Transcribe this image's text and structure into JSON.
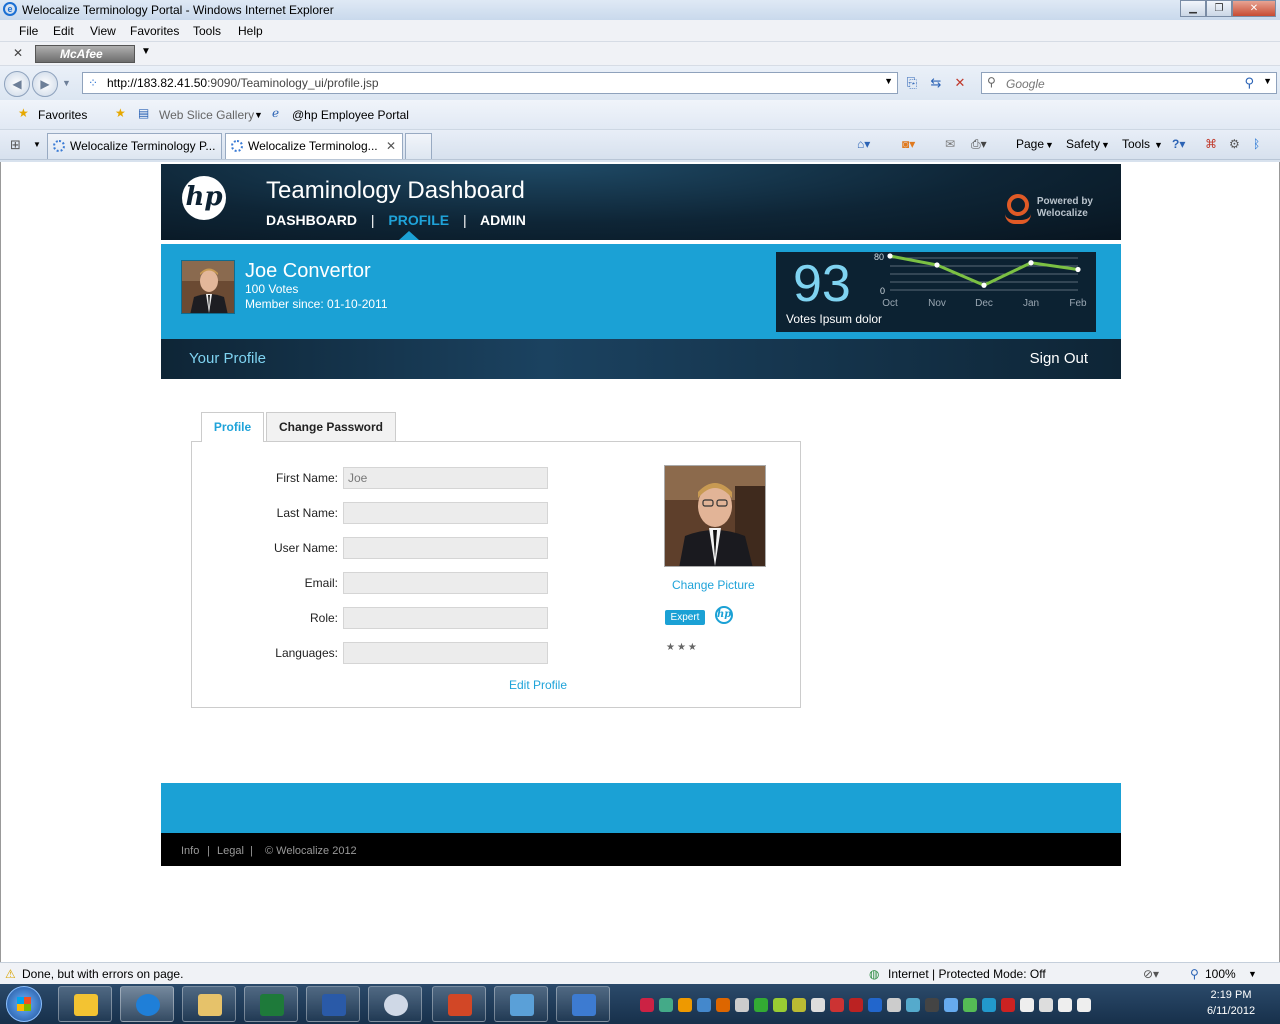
{
  "browser": {
    "window_title": "Welocalize Terminology Portal - Windows Internet Explorer",
    "menu": [
      "File",
      "Edit",
      "View",
      "Favorites",
      "Tools",
      "Help"
    ],
    "mcafee_label": "McAfee",
    "url_host": "http://183.82.41.50",
    "url_path": ":9090/Teaminology_ui/profile.jsp",
    "search_placeholder": "Google",
    "favorites_label": "Favorites",
    "fav_items": [
      "Web Slice Gallery",
      "@hp Employee Portal"
    ],
    "tabs": [
      "Welocalize Terminology P...",
      "Welocalize Terminolog..."
    ],
    "commands": [
      "Page",
      "Safety",
      "Tools"
    ]
  },
  "site": {
    "title": "Teaminology Dashboard",
    "nav": [
      "DASHBOARD",
      "PROFILE",
      "ADMIN"
    ],
    "nav_sep": "|",
    "powered_line1": "Powered by",
    "powered_line2": "Welocalize",
    "hp_logo": "hp"
  },
  "user": {
    "name": "Joe Convertor",
    "votes": "100 Votes",
    "member_since": "Member since: 01-10-2011"
  },
  "votes_widget": {
    "number": "93",
    "label": "Votes Ipsum dolor"
  },
  "chart_data": {
    "type": "line",
    "categories": [
      "Oct",
      "Nov",
      "Dec",
      "Jan",
      "Feb"
    ],
    "series": [
      {
        "values": [
          80,
          60,
          15,
          65,
          50
        ]
      }
    ],
    "ylim": [
      0,
      80
    ],
    "ytick_labels": [
      "80",
      "0"
    ],
    "color": "#7bc043"
  },
  "subnav": {
    "left": "Your Profile",
    "right": "Sign Out"
  },
  "profile_tabs": [
    "Profile",
    "Change Password"
  ],
  "form": {
    "fields": [
      {
        "label": "First Name:",
        "value": "Joe"
      },
      {
        "label": "Last Name:",
        "value": ""
      },
      {
        "label": "User Name:",
        "value": ""
      },
      {
        "label": "Email:",
        "value": ""
      },
      {
        "label": "Role:",
        "value": ""
      },
      {
        "label": "Languages:",
        "value": ""
      }
    ],
    "edit_link": "Edit Profile"
  },
  "photo_panel": {
    "change_picture": "Change Picture",
    "badge": "Expert",
    "stars": "★★★"
  },
  "footer": {
    "items": [
      "Info",
      "|",
      "Legal",
      "|",
      "© Welocalize 2012"
    ]
  },
  "statusbar": {
    "message": "Done, but with errors on page.",
    "zone": "Internet | Protected Mode: Off",
    "zoom": "100%"
  },
  "taskbar": {
    "time": "2:19 PM",
    "date": "6/11/2012"
  },
  "colors": {
    "accent": "#1ba1d5",
    "header_dark": "#0e2536",
    "link": "#1fa3d9",
    "chart_line": "#7bc043"
  }
}
